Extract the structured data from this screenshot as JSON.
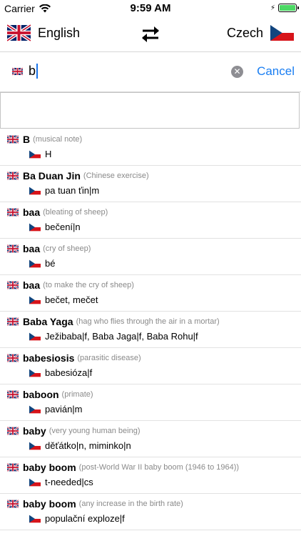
{
  "status_bar": {
    "carrier": "Carrier",
    "time": "9:59 AM",
    "battery_level": 1.0
  },
  "languages": {
    "source": "English",
    "target": "Czech",
    "source_flag": "uk-flag",
    "target_flag": "czech-flag"
  },
  "search": {
    "query": "b",
    "cancel_label": "Cancel"
  },
  "results": [
    {
      "headword": "B",
      "note": "(musical note)",
      "translation": "H"
    },
    {
      "headword": "Ba Duan Jin",
      "note": "(Chinese exercise)",
      "translation": "pa tuan ťin|m"
    },
    {
      "headword": "baa",
      "note": "(bleating of sheep)",
      "translation": "bečení|n"
    },
    {
      "headword": "baa",
      "note": "(cry of sheep)",
      "translation": "bé"
    },
    {
      "headword": "baa",
      "note": "(to make the cry of sheep)",
      "translation": "bečet, mečet"
    },
    {
      "headword": "Baba Yaga",
      "note": "(hag who flies through the air in a mortar)",
      "translation": "Ježibaba|f, Baba Jaga|f, Baba Rohu|f"
    },
    {
      "headword": "babesiosis",
      "note": "(parasitic disease)",
      "translation": "babesióza|f"
    },
    {
      "headword": "baboon",
      "note": "(primate)",
      "translation": "pavián|m"
    },
    {
      "headword": "baby",
      "note": "(very young human being)",
      "translation": "děťátko|n, miminko|n"
    },
    {
      "headword": "baby boom",
      "note": "(post-World War II baby boom (1946 to 1964))",
      "translation": "t-needed|cs"
    },
    {
      "headword": "baby boom",
      "note": "(any increase in the birth rate)",
      "translation": "populační exploze|f"
    }
  ],
  "colors": {
    "accent": "#1a7ef2",
    "uk_blue": "#012169",
    "uk_red": "#C8102E",
    "cz_blue": "#11457E",
    "cz_red": "#D7141A"
  }
}
